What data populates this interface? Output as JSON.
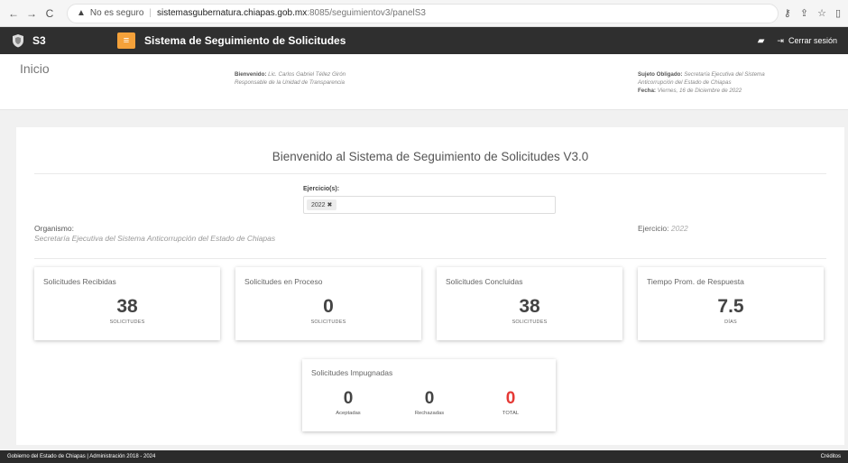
{
  "browser": {
    "back": "←",
    "forward": "→",
    "reload": "C",
    "not_secure": "No es seguro",
    "url_host": "sistemasgubernatura.chiapas.gob.mx",
    "url_path": ":8085/seguimientov3/panelS3"
  },
  "navbar": {
    "brand": "S3",
    "title": "Sistema de Seguimiento de Solicitudes",
    "logout": "Cerrar sesión"
  },
  "header": {
    "page": "Inicio",
    "welcome_label": "Bienvenido:",
    "welcome_name": "Lic. Carlos Gabriel Téllez Girón",
    "welcome_role": "Responsable de la Unidad de Transparencia",
    "subject_label": "Sujeto Obligado:",
    "subject_value_1": "Secretaría Ejecutiva del Sistema",
    "subject_value_2": "Anticorrupción del Estado de Chiapas",
    "date_label": "Fecha:",
    "date_value": "Viernes, 16 de Diciembre de 2022"
  },
  "panel": {
    "title": "Bienvenido al Sistema de Seguimiento de Solicitudes V3.0",
    "ejercicios_label": "Ejercicio(s):",
    "ejercicio_chip": "2022 ✖",
    "organismo_label": "Organismo:",
    "organismo_value": "Secretaría Ejecutiva del Sistema Anticorrupción del Estado de Chiapas",
    "ejercicio_label": "Ejercicio:",
    "ejercicio_value": "2022"
  },
  "cards": [
    {
      "title": "Solicitudes Recibidas",
      "value": "38",
      "unit": "SOLICITUDES"
    },
    {
      "title": "Solicitudes en Proceso",
      "value": "0",
      "unit": "SOLICITUDES"
    },
    {
      "title": "Solicitudes Concluidas",
      "value": "38",
      "unit": "SOLICITUDES"
    },
    {
      "title": "Tiempo Prom. de Respuesta",
      "value": "7.5",
      "unit": "DÍAS"
    }
  ],
  "impugnadas": {
    "title": "Solicitudes Impugnadas",
    "aceptadas_value": "0",
    "aceptadas_label": "Aceptadas",
    "rechazadas_value": "0",
    "rechazadas_label": "Rechazadas",
    "total_value": "0",
    "total_label": "TOTAL",
    "total_color": "#e53935"
  },
  "footer": {
    "left": "Gobierno del Estado de Chiapas | Administración 2018 - 2024",
    "right": "Créditos"
  },
  "colors": {
    "accent": "#f4a13a",
    "navbar": "#2f2f2f"
  }
}
